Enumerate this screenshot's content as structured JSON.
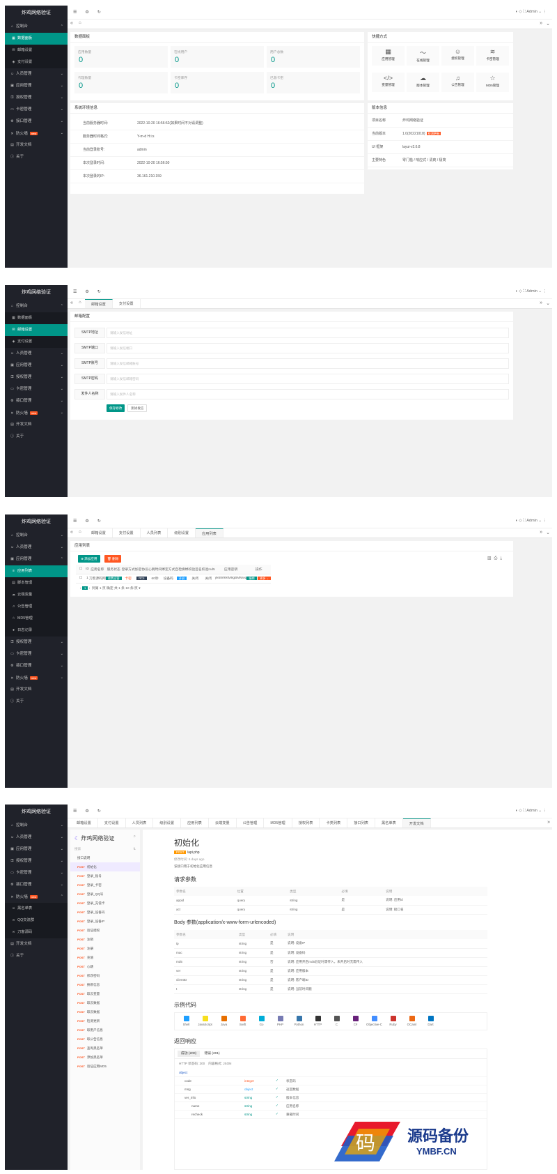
{
  "app": {
    "title": "炸鸡网络验证",
    "admin": "Admin"
  },
  "nav": {
    "console": "控制台",
    "dashboard": "数据面板",
    "mail": "邮箱设置",
    "pay": "支付设置",
    "staff": "人员管理",
    "app": "应用管理",
    "auth": "授权管理",
    "card": "卡密管理",
    "api": "接口管理",
    "firewall": "防火墙",
    "new": "new",
    "dev": "开发文档",
    "about": "关于",
    "app_list": "应用列表",
    "script": "脚本管理",
    "cloud_var": "云端变量",
    "notice": "公告管理",
    "md5": "MD5管理",
    "log": "日志记录",
    "blacklist": "黑名单表",
    "qq_group": "QQ交流群",
    "knife": "刀客源码"
  },
  "s1": {
    "stats_title": "数据面板",
    "stats": [
      {
        "label": "应用数量",
        "value": "0"
      },
      {
        "label": "在线用户",
        "value": "0"
      },
      {
        "label": "用户总数",
        "value": "0"
      },
      {
        "label": "代理数量",
        "value": "0"
      },
      {
        "label": "卡密库存",
        "value": "0"
      },
      {
        "label": "已激卡密",
        "value": "0"
      }
    ],
    "quick_title": "快捷方式",
    "quick": [
      {
        "label": "应用管理",
        "icon": "grid-icon"
      },
      {
        "label": "在线管理",
        "icon": "pulse-icon"
      },
      {
        "label": "授权管理",
        "icon": "user-icon"
      },
      {
        "label": "卡密管理",
        "icon": "layers-icon"
      },
      {
        "label": "变量管理",
        "icon": "code-icon"
      },
      {
        "label": "版本管理",
        "icon": "upload-icon"
      },
      {
        "label": "公告管理",
        "icon": "bell-icon"
      },
      {
        "label": "MD5管理",
        "icon": "star-icon"
      }
    ],
    "env_title": "系统环境信息",
    "env": [
      {
        "k": "当前服务器时间:",
        "v": "2022-10-20 16:56:52(如果时间不对请调整)"
      },
      {
        "k": "服务器时间格式:",
        "v": "Y-m-d H:i:s"
      },
      {
        "k": "当前登录账号:",
        "v": "admin"
      },
      {
        "k": "本次登录时间:",
        "v": "2022-10-20 16:56:50"
      },
      {
        "k": "本次登录的IP:",
        "v": "36.161.210.159"
      }
    ],
    "ver_title": "版本信息",
    "ver": [
      {
        "k": "项目名称",
        "v": "炸鸡网络验证"
      },
      {
        "k": "当前版本",
        "v": "1.0(20221018)",
        "badge": "检测更新"
      },
      {
        "k": "UI 框架",
        "v": "layui-v2.6.8"
      },
      {
        "k": "主要特色",
        "v": "零门槛 / 响应式 / 清爽 / 极简"
      }
    ]
  },
  "s2": {
    "tabs": [
      "邮箱设置",
      "支付设置"
    ],
    "title": "邮箱配置",
    "fields": [
      {
        "label": "SMTP地址",
        "ph": "请输入发信地址"
      },
      {
        "label": "SMTP端口",
        "ph": "请输入发信端口"
      },
      {
        "label": "SMTP账号",
        "ph": "请输入发信邮箱账号"
      },
      {
        "label": "SMTP密码",
        "ph": "请输入发信邮箱密码"
      },
      {
        "label": "发件人名称",
        "ph": "请输入发件人名称"
      }
    ],
    "save": "保存修改",
    "test": "测试发信"
  },
  "s3": {
    "tabs": [
      "邮箱设置",
      "支付设置",
      "人员列表",
      "级别设置",
      "应用列表"
    ],
    "title": "应用列表",
    "add": "添加应用",
    "del": "删除",
    "cols": [
      "ID",
      "应用名称",
      "服务状态",
      "登录方式",
      "加密协议",
      "心跳时间",
      "绑定方式",
      "自检换绑",
      "校验签名",
      "校验md5",
      "应用密钥",
      "操作"
    ],
    "row": [
      "1",
      "刀客源码网",
      "收费运营",
      "卡密",
      "RC4",
      "60秒",
      "设备码",
      "开启",
      "关闭",
      "关闭",
      "yk68r9tKM9gBMMwq"
    ],
    "edit": "编辑",
    "more": "更多",
    "pager": {
      "page": "1",
      "goto": "到第",
      "p": "1",
      "pg": "页",
      "ok": "确定",
      "total": "共 1 条",
      "per": "10 条/页"
    }
  },
  "s4": {
    "tabs": [
      "邮箱设置",
      "支付设置",
      "人员列表",
      "级别设置",
      "应用列表",
      "云端变量",
      "公告管理",
      "MD5管理",
      "授权列表",
      "卡类列表",
      "接口列表",
      "黑名单表",
      "开发文档"
    ],
    "brand": "炸鸡网络验证",
    "search": "搜索",
    "apis": [
      "接口说明",
      "初始化",
      "登录_账号",
      "登录_卡密",
      "登录_QQ号",
      "登录_充值卡",
      "登录_设备码",
      "登录_设备IP",
      "验证授权",
      "注销",
      "注册",
      "充值",
      "心跳",
      "修改密码",
      "换绑信息",
      "取云变量",
      "取云数据",
      "取云数据",
      "检测更新",
      "取用户信息",
      "取公告信息",
      "查询黑名单",
      "添加黑名单",
      "验证应用MD5"
    ],
    "post": "POST",
    "doc_title": "初始化",
    "path": "/api.php",
    "updated": "修改时间: 6 days ago",
    "desc": "该接口用于初始化应用信息",
    "req_title": "请求参数",
    "req_cols": [
      "参数名",
      "位置",
      "类型",
      "必填",
      "说明"
    ],
    "req": [
      [
        "appid",
        "query",
        "string",
        "是",
        "说明: 应用id"
      ],
      [
        "act",
        "query",
        "string",
        "是",
        "说明: 接口名"
      ]
    ],
    "body_title": "Body 参数(application/x-www-form-urlencoded)",
    "body_cols": [
      "参数名",
      "类型",
      "必填",
      "说明"
    ],
    "body": [
      [
        "ip",
        "string",
        "是",
        "说明: 设备IP"
      ],
      [
        "mac",
        "string",
        "是",
        "说明: 设备码"
      ],
      [
        "md5",
        "string",
        "否",
        "说明: 应用开启md5验证时需传入，未开启时无需传入"
      ],
      [
        "ver",
        "string",
        "是",
        "说明: 应用版本"
      ],
      [
        "clientID",
        "string",
        "是",
        "说明: 客户端ID"
      ],
      [
        "t",
        "string",
        "是",
        "说明: 当前时间戳"
      ]
    ],
    "code_title": "示例代码",
    "langs": [
      "Shell",
      "JavaScript",
      "Java",
      "Swift",
      "Go",
      "PHP",
      "Python",
      "HTTP",
      "C",
      "C#",
      "Objective-C",
      "Ruby",
      "OCaml",
      "Dart"
    ],
    "resp_title": "返回响应",
    "resp_tabs": [
      "成功 (200)",
      "错误 (201)"
    ],
    "status": "HTTP 状态码: 200",
    "format": "内容格式: JSON",
    "schema": [
      [
        "object",
        "",
        ""
      ],
      [
        "code",
        "integer",
        "状态码"
      ],
      [
        "msg",
        "object",
        "返回数据"
      ],
      [
        "ver_info",
        "string",
        "版本信息"
      ],
      [
        "name",
        "string",
        "应用名称"
      ],
      [
        "recheck",
        "string",
        "重载时间"
      ]
    ]
  },
  "watermark": {
    "title": "源码备份",
    "url": "YMBF.CN"
  }
}
